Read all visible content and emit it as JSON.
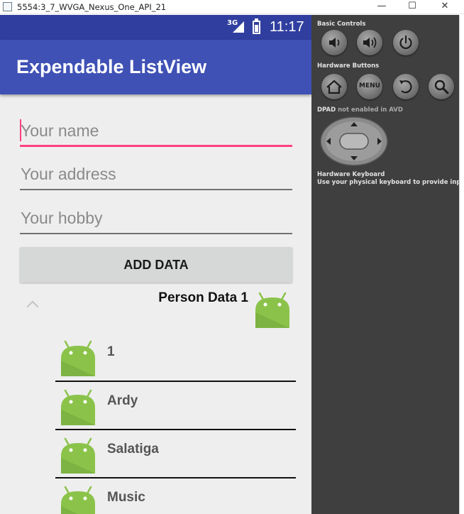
{
  "window": {
    "title": "5554:3_7_WVGA_Nexus_One_API_21",
    "controls": [
      "—",
      "☐",
      "✕"
    ]
  },
  "status_bar": {
    "network": "3G",
    "time": "11:17"
  },
  "app_bar": {
    "title": "Expendable ListView"
  },
  "form": {
    "name_placeholder": "Your name",
    "address_placeholder": "Your address",
    "hobby_placeholder": "Your hobby",
    "add_button": "ADD DATA"
  },
  "list": {
    "group_label": "Person Data 1",
    "children": [
      "1",
      "Ardy",
      "Salatiga",
      "Music"
    ]
  },
  "emulator_panel": {
    "basic_controls": "Basic Controls",
    "hardware_buttons": "Hardware Buttons",
    "menu_label": "MENU",
    "dpad_label": "DPAD",
    "dpad_note": "not enabled in AVD",
    "hardware_keyboard": "Hardware Keyboard",
    "keyboard_note": "Use your physical keyboard to provide input"
  },
  "colors": {
    "status_bar": "#303f9f",
    "app_bar": "#3f51b5",
    "accent": "#ff4081",
    "android_green": "#8bc34a",
    "panel": "#3f3f3f"
  },
  "icons": [
    "app-window-icon",
    "signal-icon",
    "battery-icon",
    "chevron-up-icon",
    "android-icon",
    "volume-down-icon",
    "volume-up-icon",
    "power-icon",
    "home-icon",
    "back-icon",
    "search-icon",
    "dpad-icon"
  ]
}
